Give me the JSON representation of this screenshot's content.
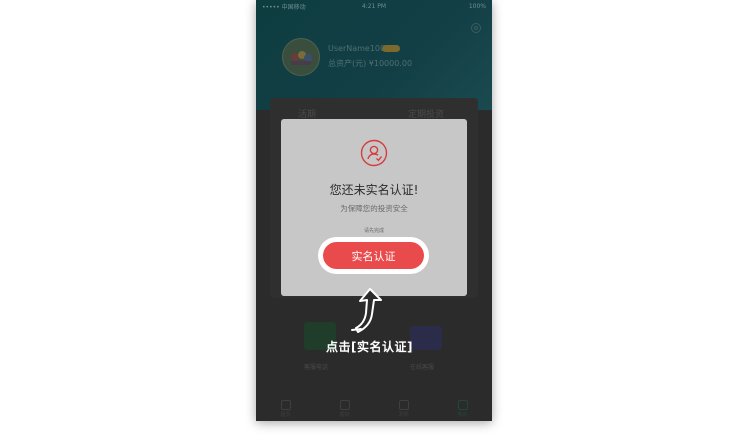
{
  "status_bar": {
    "carrier": "••••• 中国移动",
    "time": "4:21 PM",
    "battery": "100%"
  },
  "profile": {
    "username": "UserName100",
    "balance": "总资产(元) ¥10000.00"
  },
  "tabs": {
    "left": "活期",
    "right": "定期投资"
  },
  "quick_actions": {
    "left_label": "客服电话",
    "right_label": "在线客服"
  },
  "tabbar": [
    "首页",
    "理财",
    "发现",
    "我的"
  ],
  "modal": {
    "title": "您还未实名认证!",
    "subtitle": "为保障您的投资安全",
    "hint": "请先完成",
    "button_label": "实名认证"
  },
  "instruction": "点击[实名认证]",
  "colors": {
    "accent": "#e94a4c",
    "overlay": "#2b2b2b",
    "modal_bg": "#c7c7c7"
  }
}
